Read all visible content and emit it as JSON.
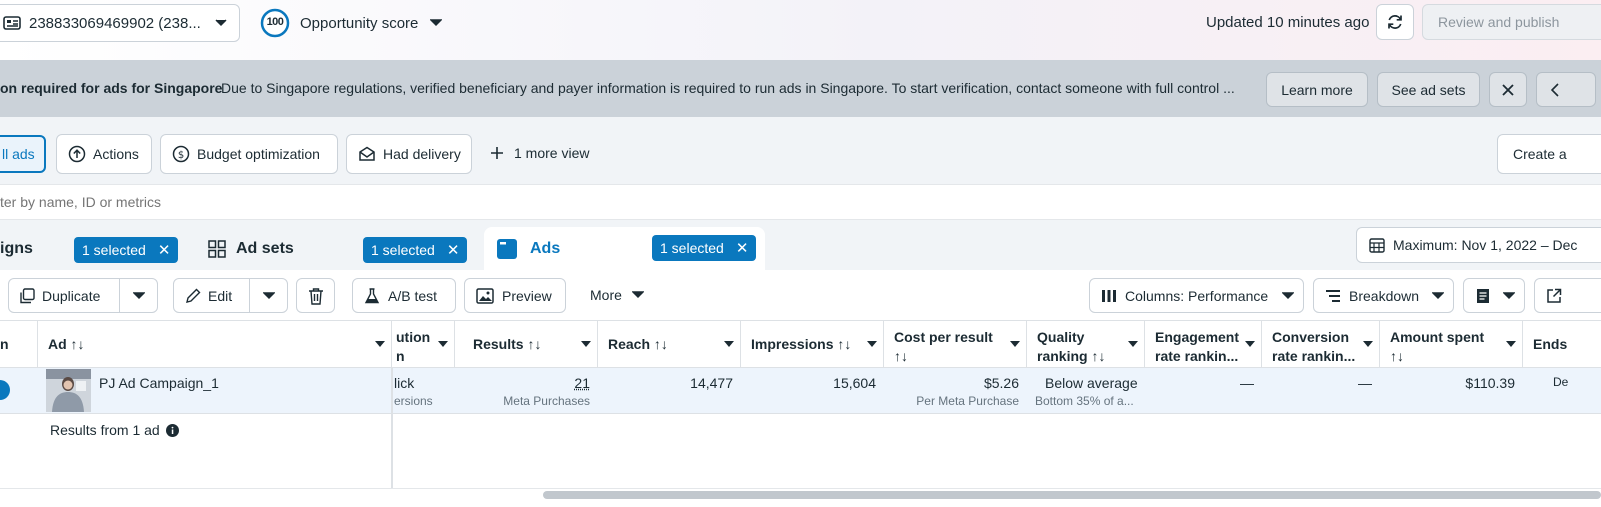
{
  "topbar": {
    "account_id": "238833069469902 (238...",
    "score_value": "100",
    "score_label": "Opportunity score",
    "updated": "Updated 10 minutes ago",
    "review_publish": "Review and publish"
  },
  "banner": {
    "title": "on required for ads for Singapore",
    "message": "Due to Singapore regulations, verified beneficiary and payer information is required to run ads in Singapore. To start verification, contact someone with full control ...",
    "learn_more": "Learn more",
    "see_ad_sets": "See ad sets"
  },
  "views": {
    "all_ads": "ll ads",
    "actions": "Actions",
    "budget_optimization": "Budget optimization",
    "had_delivery": "Had delivery",
    "more_view": "1 more view",
    "create": "Create a"
  },
  "search": {
    "placeholder": "ter by name, ID or metrics"
  },
  "tabs": {
    "campaigns": "igns",
    "campaigns_selected": "1 selected",
    "ad_sets": "Ad sets",
    "ad_sets_selected": "1 selected",
    "ads": "Ads",
    "ads_selected": "1 selected",
    "date_range": "Maximum: Nov 1, 2022 – Dec"
  },
  "toolbar": {
    "duplicate": "Duplicate",
    "edit": "Edit",
    "ab_test": "A/B test",
    "preview": "Preview",
    "more": "More",
    "columns": "Columns: Performance",
    "breakdown": "Breakdown"
  },
  "table": {
    "headers": {
      "col0": "n",
      "ad": "Ad ↑↓",
      "attribution_1": "ution",
      "attribution_2": "n",
      "results": "Results ↑↓",
      "reach": "Reach ↑↓",
      "impressions": "Impressions ↑↓",
      "cost_per_result_1": "Cost per result",
      "cost_per_result_2": "↑↓",
      "quality_1": "Quality",
      "quality_2": "ranking ↑↓",
      "engagement_1": "Engagement",
      "engagement_2": "rate rankin...",
      "conversion_1": "Conversion",
      "conversion_2": "rate rankin...",
      "amount_1": "Amount spent",
      "amount_2": "↑↓",
      "ends": "Ends"
    },
    "row": {
      "ad_name": "PJ Ad Campaign_1",
      "attribution_1": "lick",
      "attribution_2": "ersions",
      "results": "21",
      "results_sub": "Meta Purchases",
      "reach": "14,477",
      "impressions": "15,604",
      "cost_per_result": "$5.26",
      "cost_sub": "Per Meta Purchase",
      "quality": "Below average",
      "quality_sub": "Bottom 35% of a...",
      "engagement": "—",
      "conversion": "—",
      "amount": "$110.39",
      "ends": "De"
    },
    "summary": "Results from 1 ad"
  },
  "colors": {
    "accent": "#0a78be",
    "banner_bg": "#cbd2d9",
    "row_selected": "#edf4fc"
  }
}
